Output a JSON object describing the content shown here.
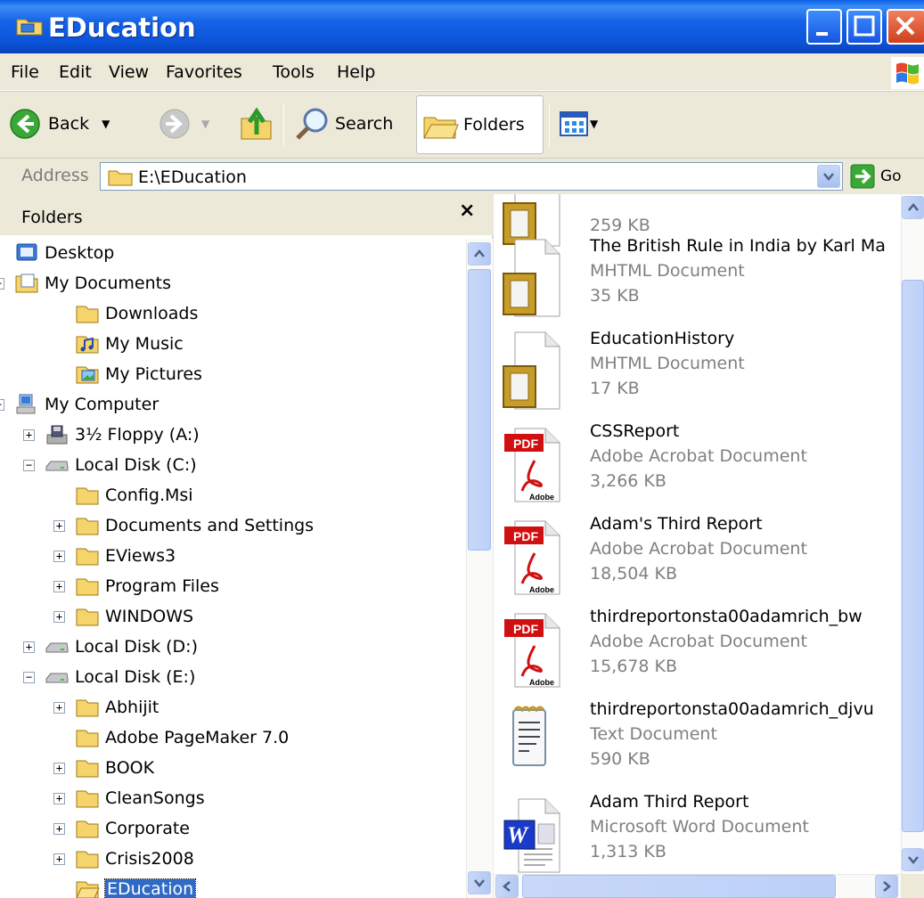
{
  "window": {
    "title": "EDucation"
  },
  "menu": [
    "File",
    "Edit",
    "View",
    "Favorites",
    "Tools",
    "Help"
  ],
  "toolbar": {
    "back": "Back",
    "search": "Search",
    "folders": "Folders"
  },
  "address": {
    "label": "Address",
    "value": "E:\\EDucation",
    "go": "Go"
  },
  "folders_pane": {
    "title": "Folders",
    "close": "×",
    "tree": [
      {
        "label": "Desktop",
        "icon": "desktop-icon",
        "expander": ""
      },
      {
        "label": "My Documents",
        "icon": "my-documents-icon",
        "expander": "−"
      },
      {
        "label": "Downloads",
        "icon": "folder-icon",
        "expander": ""
      },
      {
        "label": "My Music",
        "icon": "music-folder-icon",
        "expander": ""
      },
      {
        "label": "My Pictures",
        "icon": "pictures-folder-icon",
        "expander": ""
      },
      {
        "label": "My Computer",
        "icon": "computer-icon",
        "expander": "−"
      },
      {
        "label": "3½ Floppy (A:)",
        "icon": "floppy-icon",
        "expander": "+"
      },
      {
        "label": "Local Disk (C:)",
        "icon": "drive-icon",
        "expander": "−"
      },
      {
        "label": "Config.Msi",
        "icon": "folder-icon",
        "expander": ""
      },
      {
        "label": "Documents and Settings",
        "icon": "folder-icon",
        "expander": "+"
      },
      {
        "label": "EViews3",
        "icon": "folder-icon",
        "expander": "+"
      },
      {
        "label": "Program Files",
        "icon": "folder-icon",
        "expander": "+"
      },
      {
        "label": "WINDOWS",
        "icon": "folder-icon",
        "expander": "+"
      },
      {
        "label": "Local Disk (D:)",
        "icon": "drive-icon",
        "expander": "+"
      },
      {
        "label": "Local Disk (E:)",
        "icon": "drive-icon",
        "expander": "−"
      },
      {
        "label": "Abhijit",
        "icon": "folder-icon",
        "expander": "+"
      },
      {
        "label": "Adobe PageMaker 7.0",
        "icon": "folder-icon",
        "expander": ""
      },
      {
        "label": "BOOK",
        "icon": "folder-icon",
        "expander": "+"
      },
      {
        "label": "CleanSongs",
        "icon": "folder-icon",
        "expander": "+"
      },
      {
        "label": "Corporate",
        "icon": "folder-icon",
        "expander": "+"
      },
      {
        "label": "Crisis2008",
        "icon": "folder-icon",
        "expander": "+"
      },
      {
        "label": "EDucation",
        "icon": "folder-open-icon",
        "expander": ""
      }
    ]
  },
  "files": [
    {
      "name": "",
      "type": "",
      "size": "259 KB",
      "icon": "mhtml-icon"
    },
    {
      "name": "The British Rule in India by Karl Ma",
      "type": "MHTML Document",
      "size": "35 KB",
      "icon": "mhtml-icon"
    },
    {
      "name": "EducationHistory",
      "type": "MHTML Document",
      "size": "17 KB",
      "icon": "mhtml-icon"
    },
    {
      "name": "CSSReport",
      "type": "Adobe Acrobat Document",
      "size": "3,266 KB",
      "icon": "pdf-icon"
    },
    {
      "name": "Adam's Third Report",
      "type": "Adobe Acrobat Document",
      "size": "18,504 KB",
      "icon": "pdf-icon"
    },
    {
      "name": "thirdreportonsta00adamrich_bw",
      "type": "Adobe Acrobat Document",
      "size": "15,678 KB",
      "icon": "pdf-icon"
    },
    {
      "name": "thirdreportonsta00adamrich_djvu",
      "type": "Text Document",
      "size": "590 KB",
      "icon": "text-document-icon"
    },
    {
      "name": "Adam Third Report",
      "type": "Microsoft Word Document",
      "size": "1,313 KB",
      "icon": "word-document-icon"
    }
  ],
  "colors": {
    "titlebar": "#0a53d8",
    "selection": "#316ac5",
    "pdf_red": "#d01010"
  }
}
